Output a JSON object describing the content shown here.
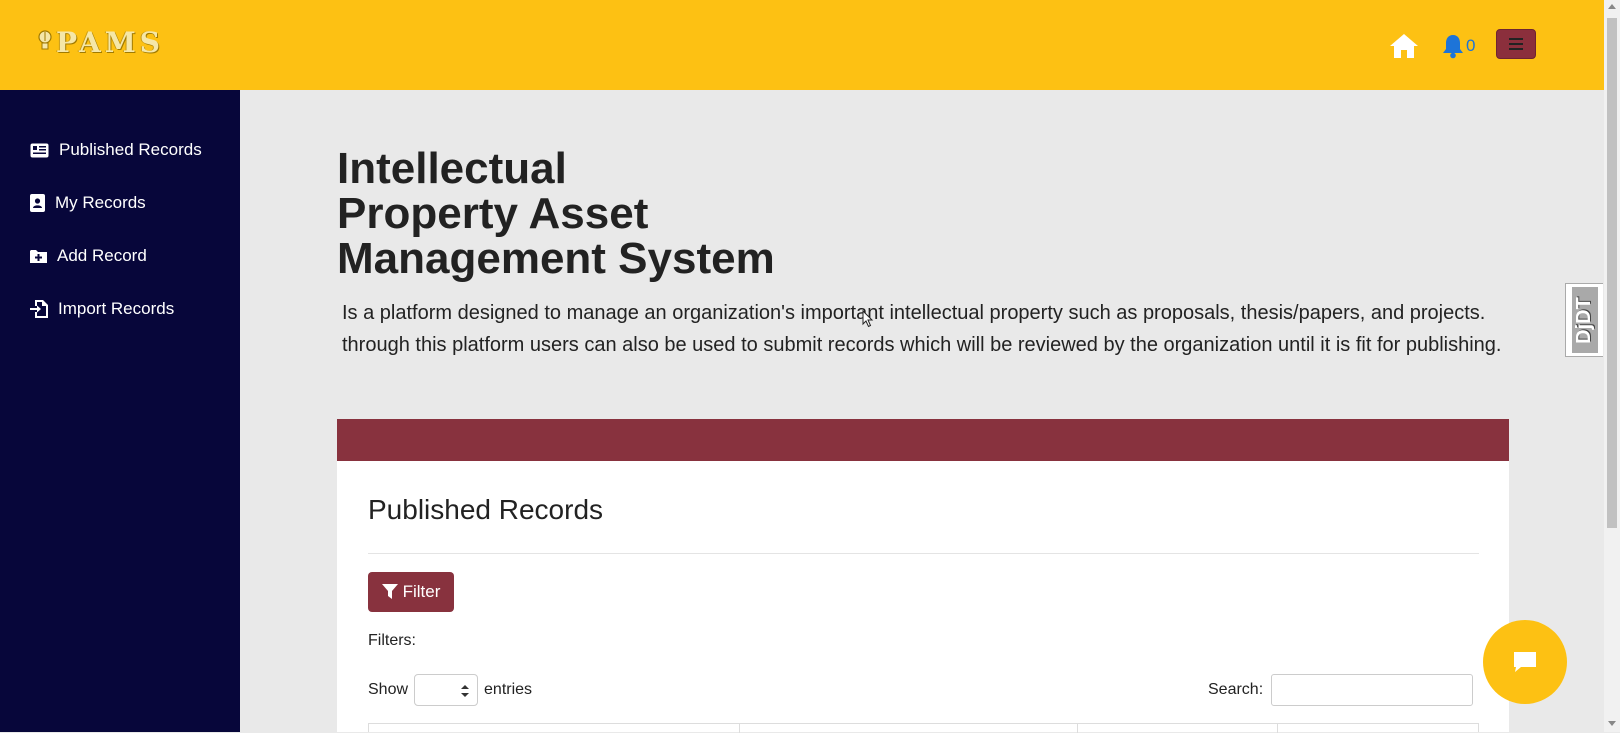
{
  "header": {
    "logo_text": "PAMS",
    "notification_count": "0",
    "colors": {
      "bar": "#fdc113",
      "menu_button": "#8b2f3c",
      "bell": "#1d74d8"
    }
  },
  "sidebar": {
    "items": [
      {
        "label": "Published Records",
        "icon": "newspaper-icon"
      },
      {
        "label": "My Records",
        "icon": "user-file-icon"
      },
      {
        "label": "Add Record",
        "icon": "folder-plus-icon"
      },
      {
        "label": "Import Records",
        "icon": "file-import-icon"
      }
    ],
    "color": "#07063a"
  },
  "main": {
    "title_lines": [
      "Intellectual",
      "Property Asset",
      "Management System"
    ],
    "description": "Is a platform designed to manage an organization's important intellectual property such as proposals, thesis/papers, and projects. through this platform users can also be used to submit records which will be reviewed by the organization until it is fit for publishing.",
    "card": {
      "header_color": "#88323e",
      "title": "Published Records",
      "filter_label": "Filter",
      "filters_label": "Filters:",
      "show_label": "Show",
      "entries_label": "entries",
      "search_label": "Search:",
      "search_value": ""
    }
  },
  "debug_toolbar": {
    "label": "DjDT"
  }
}
